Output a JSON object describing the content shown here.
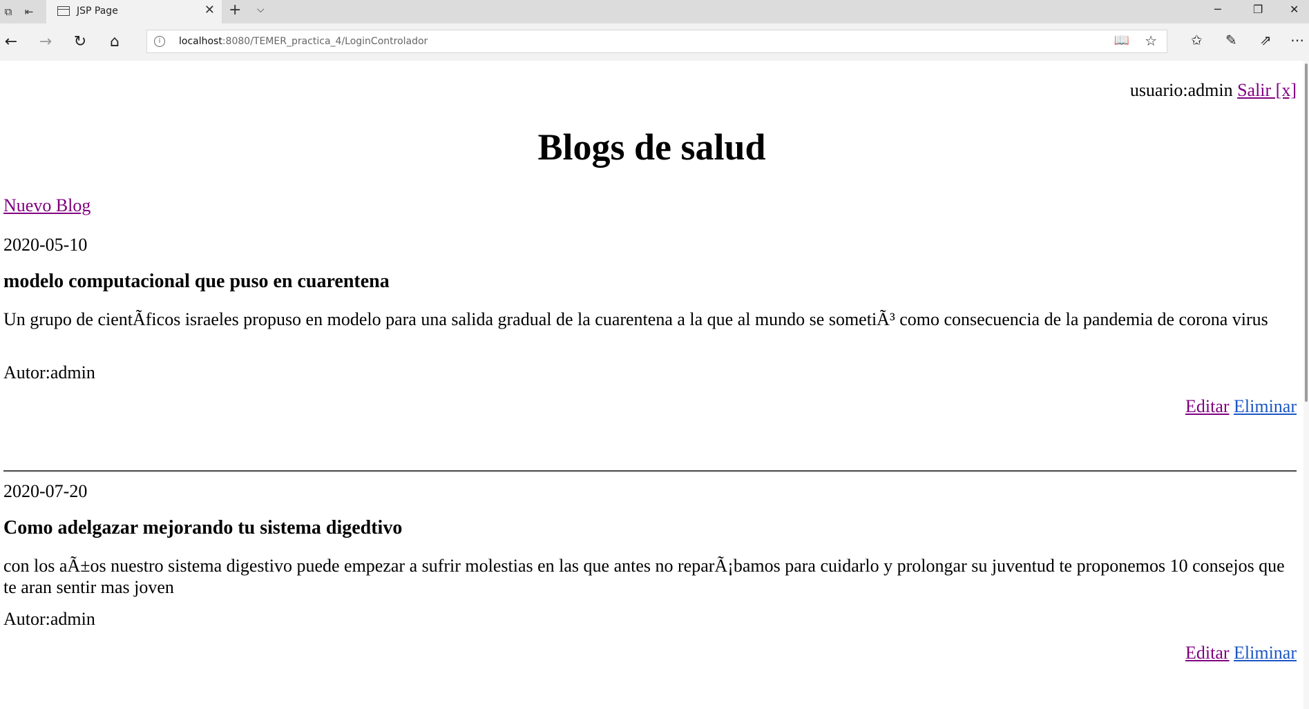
{
  "browser": {
    "tab_title": "JSP Page",
    "url_host": "localhost",
    "url_rest": ":8080/TEMER_practica_4/LoginControlador"
  },
  "header": {
    "user_label": "usuario:admin",
    "logout_link": "Salir [x]"
  },
  "page": {
    "title": "Blogs de salud",
    "new_blog_link": "Nuevo Blog"
  },
  "posts": [
    {
      "date": "2020-05-10",
      "title": "modelo computacional que puso en cuarentena",
      "body": "Un grupo de cientÃficos israeles propuso en modelo para una salida gradual de la cuarentena a la que al mundo se sometiÃ³ como consecuencia de la pandemia de corona virus",
      "author": "Autor:admin",
      "edit_label": "Editar",
      "delete_label": "Eliminar"
    },
    {
      "date": "2020-07-20",
      "title": "Como adelgazar mejorando tu sistema digedtivo",
      "body": "con los aÃ±os nuestro sistema digestivo puede empezar a sufrir molestias en las que antes no reparÃ¡bamos para cuidarlo y prolongar su juventud te proponemos 10 consejos que te aran sentir mas joven",
      "author": "Autor:admin",
      "edit_label": "Editar",
      "delete_label": "Eliminar"
    }
  ],
  "colors": {
    "visited_link": "#800080",
    "link": "#1a56c4"
  }
}
